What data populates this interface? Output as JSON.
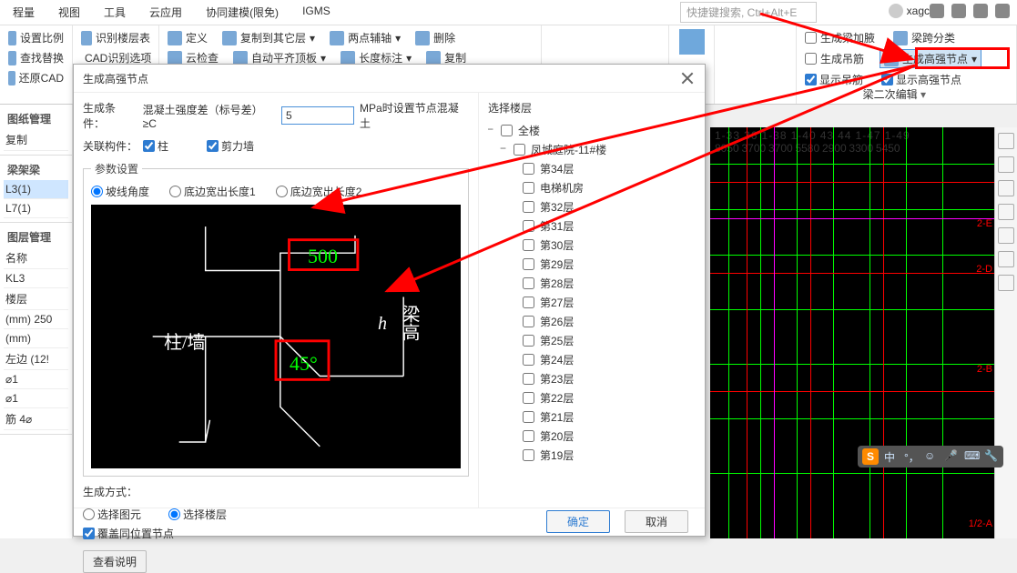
{
  "tabs": [
    "程量",
    "视图",
    "工具",
    "云应用",
    "协同建模(限免)",
    "IGMS"
  ],
  "search_placeholder": "快捷键搜索, Ctrl+Alt+E",
  "account": "xagcc",
  "ribbon_left": [
    "设置比例",
    "识别楼层表",
    "查找替换",
    "CAD识别选项",
    "还原CAD"
  ],
  "ribbon_mid_top": [
    "定义",
    "复制到其它层",
    "两点辅轴",
    "删除"
  ],
  "ribbon_mid_bot": [
    "云检查",
    "自动平齐顶板",
    "长度标注",
    "复制"
  ],
  "ribbon_right": [
    {
      "label": "生成梁加腋",
      "chk": false
    },
    {
      "label": "梁跨分类",
      "chk": false
    },
    {
      "label": "生成吊筋",
      "chk": false
    },
    {
      "label": "生成高强节点",
      "chk": false,
      "hl": true
    },
    {
      "label": "显示吊筋",
      "chk": true
    },
    {
      "label": "显示高强节点",
      "chk": true
    }
  ],
  "sub_ribbon": "梁二次编辑",
  "left_panels": {
    "p1": "图纸",
    "p1b": "图纸管理",
    "copy": "复制",
    "frame": "梁架梁",
    "items": [
      "L3(1)",
      "L7(1)"
    ],
    "layer": "图层管理",
    "name_hdr": "名称",
    "rows": [
      "KL3",
      "楼层",
      "(mm)   250",
      "(mm)",
      "左边    (12!",
      "⌀1",
      "⌀1",
      "筋   4⌀"
    ]
  },
  "dlg": {
    "title": "生成高强节点",
    "cond_label": "生成条件：",
    "cond_text1": "混凝土强度差（标号差）≥C",
    "cond_val": "5",
    "cond_text2": "MPa时设置节点混凝土",
    "assoc_label": "关联构件：",
    "chk_col": "柱",
    "chk_wall": "剪力墙",
    "param_title": "参数设置",
    "radios": [
      "坡线角度",
      "底边宽出长度1",
      "底边宽出长度2"
    ],
    "diag": {
      "v1": "500",
      "v2": "45°",
      "lab1": "柱/墙",
      "lab2": "梁高",
      "h": "h"
    },
    "gen_label": "生成方式：",
    "gen_r1": "选择图元",
    "gen_r2": "选择楼层",
    "overwrite": "覆盖同位置节点",
    "explain": "查看说明",
    "tree_title": "选择楼层",
    "tree_root": "全楼",
    "tree_proj": "凤城庭院-11#楼",
    "floors": [
      "第34层",
      "电梯机房",
      "第32层",
      "第31层",
      "第30层",
      "第29层",
      "第28层",
      "第27层",
      "第26层",
      "第25层",
      "第24层",
      "第23层",
      "第22层",
      "第21层",
      "第20层",
      "第19层"
    ],
    "ok": "确定",
    "cancel": "取消"
  },
  "canvas_top": [
    "1-33",
    "36",
    "1-38",
    "1-40",
    "43",
    "44",
    "1-47",
    "1-49"
  ],
  "canvas_top2": [
    "8050",
    "3700",
    "3700",
    "5580",
    "2900",
    "3300",
    "5450"
  ],
  "canvas_side": [
    "2-E",
    "2-D",
    "2-B"
  ],
  "canvas_bot": "1/2-A",
  "ime": "S"
}
